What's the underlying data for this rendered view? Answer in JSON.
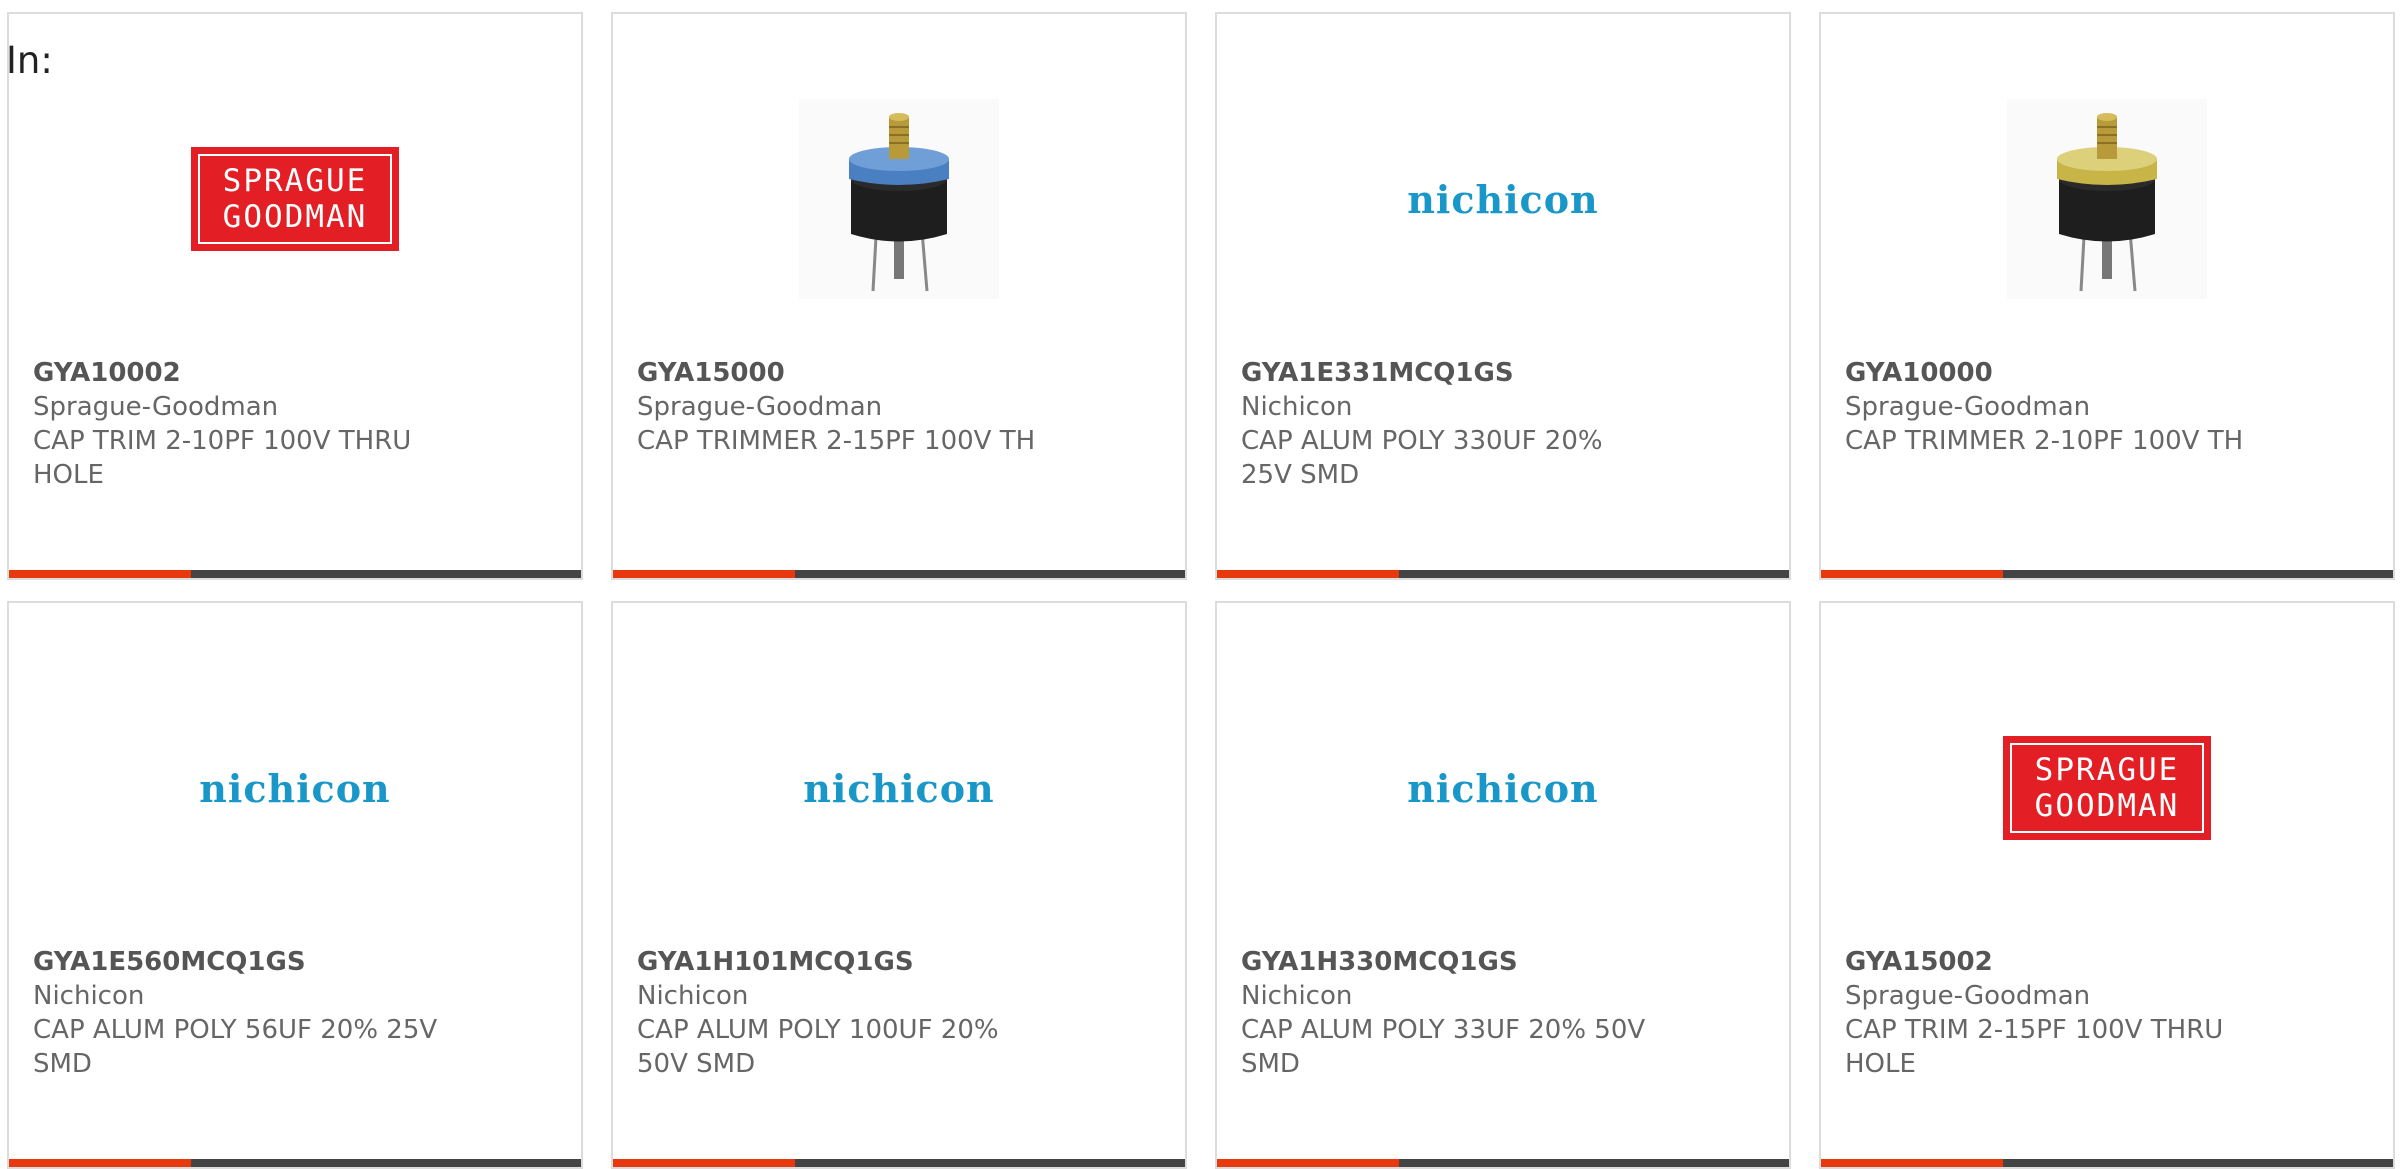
{
  "page": {
    "in_label": "In:"
  },
  "colors": {
    "accent": "#e8380d",
    "bar": "#444444",
    "nichicon": "#1a97c9",
    "sprague": "#e31e24",
    "blue_cap": "#4a7fc1",
    "gold_cap": "#c8b548"
  },
  "products": [
    {
      "part_number": "GYA10002",
      "manufacturer": "Sprague-Goodman",
      "description": "CAP TRIM 2-10PF 100V THRU HOLE",
      "image": "sprague-goodman-logo",
      "logo_line1": "SPRAGUE",
      "logo_line2": "GOODMAN"
    },
    {
      "part_number": "GYA15000",
      "manufacturer": "Sprague-Goodman",
      "description": "CAP TRIMMER 2-15PF 100V TH",
      "image": "blue-trimmer-capacitor-photo"
    },
    {
      "part_number": "GYA1E331MCQ1GS",
      "manufacturer": "Nichicon",
      "description": "CAP ALUM POLY 330UF 20% 25V SMD",
      "image": "nichicon-logo",
      "logo_text": "nichicon"
    },
    {
      "part_number": "GYA10000",
      "manufacturer": "Sprague-Goodman",
      "description": "CAP TRIMMER 2-10PF 100V TH",
      "image": "gold-trimmer-capacitor-photo"
    },
    {
      "part_number": "GYA1E560MCQ1GS",
      "manufacturer": "Nichicon",
      "description": "CAP ALUM POLY 56UF 20% 25V SMD",
      "image": "nichicon-logo",
      "logo_text": "nichicon"
    },
    {
      "part_number": "GYA1H101MCQ1GS",
      "manufacturer": "Nichicon",
      "description": "CAP ALUM POLY 100UF 20% 50V SMD",
      "image": "nichicon-logo",
      "logo_text": "nichicon"
    },
    {
      "part_number": "GYA1H330MCQ1GS",
      "manufacturer": "Nichicon",
      "description": "CAP ALUM POLY 33UF 20% 50V SMD",
      "image": "nichicon-logo",
      "logo_text": "nichicon"
    },
    {
      "part_number": "GYA15002",
      "manufacturer": "Sprague-Goodman",
      "description": "CAP TRIM 2-15PF 100V THRU HOLE",
      "image": "sprague-goodman-logo",
      "logo_line1": "SPRAGUE",
      "logo_line2": "GOODMAN"
    }
  ]
}
